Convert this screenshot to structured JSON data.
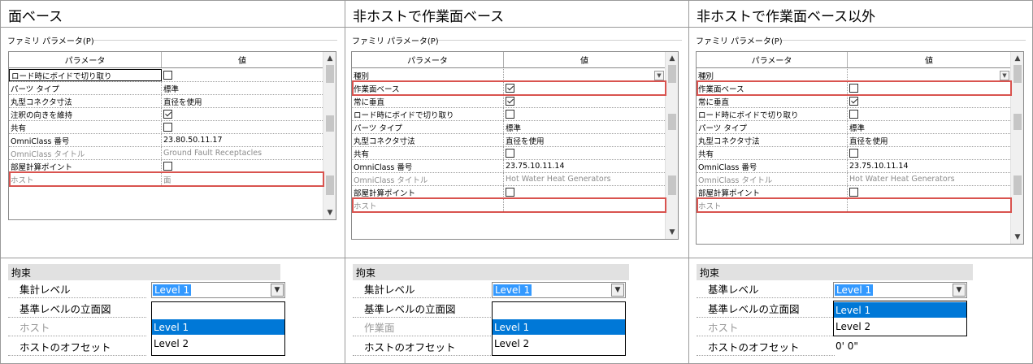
{
  "panels": [
    {
      "title": "面ベース",
      "family_params_label": "ファミリ パラメータ(P)",
      "grid_header": {
        "param": "パラメータ",
        "value": "値"
      },
      "rows": [
        {
          "name": "ロード時にボイドで切り取り",
          "value": "",
          "checkbox": false,
          "state": "selected"
        },
        {
          "name": "パーツ タイプ",
          "value": "標準"
        },
        {
          "name": "丸型コネクタ寸法",
          "value": "直径を使用"
        },
        {
          "name": "注釈の向きを維持",
          "value": "",
          "checkbox": true
        },
        {
          "name": "共有",
          "value": "",
          "checkbox": false
        },
        {
          "name": "OmniClass 番号",
          "value": "23.80.50.11.17"
        },
        {
          "name": "OmniClass タイトル",
          "value": "Ground Fault Receptacles",
          "state": "gray"
        },
        {
          "name": "部屋計算ポイント",
          "value": "",
          "checkbox": false
        },
        {
          "name": "ホスト",
          "value": "面",
          "state": "gray"
        }
      ],
      "constraints": {
        "header": "拘束",
        "rows": [
          "集計レベル",
          "基準レベルの立面図",
          "ホスト",
          "ホストのオフセット"
        ],
        "combo_value": "Level 1",
        "dropdown_options": [
          "Level 1",
          "Level 2"
        ],
        "dropdown_highlight": 0
      }
    },
    {
      "title": "非ホストで作業面ベース",
      "family_params_label": "ファミリ パラメータ(P)",
      "grid_header": {
        "param": "パラメータ",
        "value": "値"
      },
      "rows": [
        {
          "name": "種別",
          "value": "",
          "dropdown": true
        },
        {
          "name": "作業面ベース",
          "value": "",
          "checkbox": true
        },
        {
          "name": "常に垂直",
          "value": "",
          "checkbox": true
        },
        {
          "name": "ロード時にボイドで切り取り",
          "value": "",
          "checkbox": false
        },
        {
          "name": "パーツ タイプ",
          "value": "標準"
        },
        {
          "name": "丸型コネクタ寸法",
          "value": "直径を使用"
        },
        {
          "name": "共有",
          "value": "",
          "checkbox": false
        },
        {
          "name": "OmniClass 番号",
          "value": "23.75.10.11.14"
        },
        {
          "name": "OmniClass タイトル",
          "value": "Hot Water Heat Generators",
          "state": "gray"
        },
        {
          "name": "部屋計算ポイント",
          "value": "",
          "checkbox": false
        },
        {
          "name": "ホスト",
          "value": "",
          "state": "gray"
        }
      ],
      "constraints": {
        "header": "拘束",
        "rows": [
          "集計レベル",
          "基準レベルの立面図",
          "作業面",
          "ホストのオフセット"
        ],
        "combo_value": "Level 1",
        "dropdown_options": [
          "Level 1",
          "Level 2"
        ],
        "dropdown_highlight": 0
      }
    },
    {
      "title": "非ホストで作業面ベース以外",
      "family_params_label": "ファミリ パラメータ(P)",
      "grid_header": {
        "param": "パラメータ",
        "value": "値"
      },
      "rows": [
        {
          "name": "種別",
          "value": "",
          "dropdown": true
        },
        {
          "name": "作業面ベース",
          "value": "",
          "checkbox": false
        },
        {
          "name": "常に垂直",
          "value": "",
          "checkbox": true
        },
        {
          "name": "ロード時にボイドで切り取り",
          "value": "",
          "checkbox": false
        },
        {
          "name": "パーツ タイプ",
          "value": "標準"
        },
        {
          "name": "丸型コネクタ寸法",
          "value": "直径を使用"
        },
        {
          "name": "共有",
          "value": "",
          "checkbox": false
        },
        {
          "name": "OmniClass 番号",
          "value": "23.75.10.11.14"
        },
        {
          "name": "OmniClass タイトル",
          "value": "Hot Water Heat Generators",
          "state": "gray"
        },
        {
          "name": "部屋計算ポイント",
          "value": "",
          "checkbox": false
        },
        {
          "name": "ホスト",
          "value": "",
          "state": "gray"
        }
      ],
      "constraints": {
        "header": "拘束",
        "rows": [
          "基準レベル",
          "基準レベルの立面図",
          "ホスト",
          "ホストのオフセット"
        ],
        "combo_value": "Level 1",
        "dropdown_options": [
          "Level 1",
          "Level 2"
        ],
        "dropdown_highlight": 0,
        "offset_value": "0'  0\""
      }
    }
  ],
  "colors": {
    "highlight_box": "#d9534f",
    "selection": "#0078d7"
  }
}
